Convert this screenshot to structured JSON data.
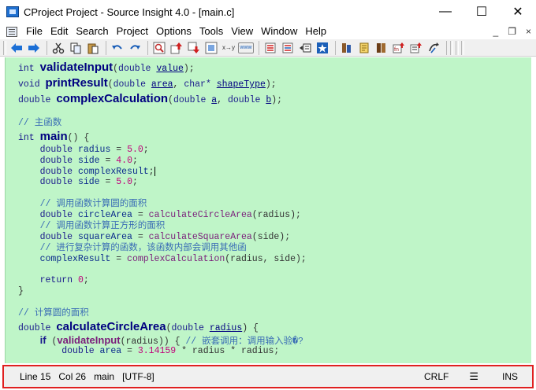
{
  "window": {
    "title": "CProject Project - Source Insight 4.0 - [main.c]",
    "minimize": "—",
    "maximize": "☐",
    "close": "✕"
  },
  "menu": {
    "items": [
      "File",
      "Edit",
      "Search",
      "Project",
      "Options",
      "Tools",
      "View",
      "Window",
      "Help"
    ],
    "mdi_minimize": "_",
    "mdi_restore": "❐",
    "mdi_close": "×"
  },
  "toolbar": {
    "icons": [
      "back-arrow-icon",
      "forward-arrow-icon",
      "cut-icon",
      "copy-icon",
      "paste-icon",
      "undo-icon",
      "redo-icon",
      "search-icon",
      "jump-up-icon",
      "jump-down-icon",
      "lookup-icon",
      "replace-icon",
      "www-icon",
      "bookmark-prev-icon",
      "bookmark-next-icon",
      "list-icon",
      "star-icon",
      "book-icon",
      "tag-icon",
      "project-icon",
      "function-icon",
      "symbol-icon",
      "sync-icon"
    ],
    "replace_text": "x→y",
    "www_text": "www"
  },
  "code": {
    "decl1": {
      "type": "int",
      "name": "validateInput",
      "p1type": "double",
      "p1": "value",
      "end": ");"
    },
    "decl2": {
      "type": "void",
      "name": "printResult",
      "p1type": "double",
      "p1": "area",
      "p2type": "char*",
      "p2": "shapeType",
      "end": ");"
    },
    "decl3": {
      "type": "double",
      "name": "complexCalculation",
      "p1type": "double",
      "p1": "a",
      "p2type": "double",
      "p2": "b",
      "end": ");"
    },
    "c_main": "// 主函数",
    "main_type": "int",
    "main_name": "main",
    "main_open": "() {",
    "v1": {
      "type": "double",
      "name": "radius",
      "eq": " = ",
      "val": "5.0",
      "end": ";"
    },
    "v2": {
      "type": "double",
      "name": "side",
      "eq": " = ",
      "val": "4.0",
      "end": ";"
    },
    "v3": {
      "type": "double",
      "name": "complexResult",
      "end": ";"
    },
    "v4": {
      "type": "double",
      "name": "side",
      "eq": " = ",
      "val": "5.0",
      "end": ";"
    },
    "c_circle": "// 调用函数计算圆的面积",
    "s_circle": {
      "type": "double",
      "name": "circleArea",
      "eq": " = ",
      "call": "calculateCircleArea",
      "args": "(radius);"
    },
    "c_square": "// 调用函数计算正方形的面积",
    "s_square": {
      "type": "double",
      "name": "squareArea",
      "eq": " = ",
      "call": "calculateSquareArea",
      "args": "(side);"
    },
    "c_complex": "// 进行复杂计算的函数，该函数内部会调用其他函",
    "s_complex": {
      "name": "complexResult",
      "eq": " = ",
      "call": "complexCalculation",
      "args": "(radius, side);"
    },
    "ret": {
      "kw": "return",
      "val": "0",
      "end": ";"
    },
    "main_close": "}",
    "c_calc": "// 计算圆的面积",
    "def": {
      "type": "double",
      "name": "calculateCircleArea",
      "p1type": "double",
      "p1": "radius",
      "end": ") {"
    },
    "ifl": {
      "kw": "if",
      "open": " (",
      "call": "validateInput",
      "args": "(radius)) { ",
      "cmt": "// 嵌套调用：调用输入验�?"
    },
    "area_line": {
      "type": "double",
      "name": "area",
      "eq": " = ",
      "val": "3.14159",
      "rest": " * radius * radius;"
    }
  },
  "status": {
    "line": "Line 15",
    "col": "Col 26",
    "func": "main",
    "encoding": "[UTF-8]",
    "eol": "CRLF",
    "menu_glyph": "☰",
    "mode": "INS"
  }
}
